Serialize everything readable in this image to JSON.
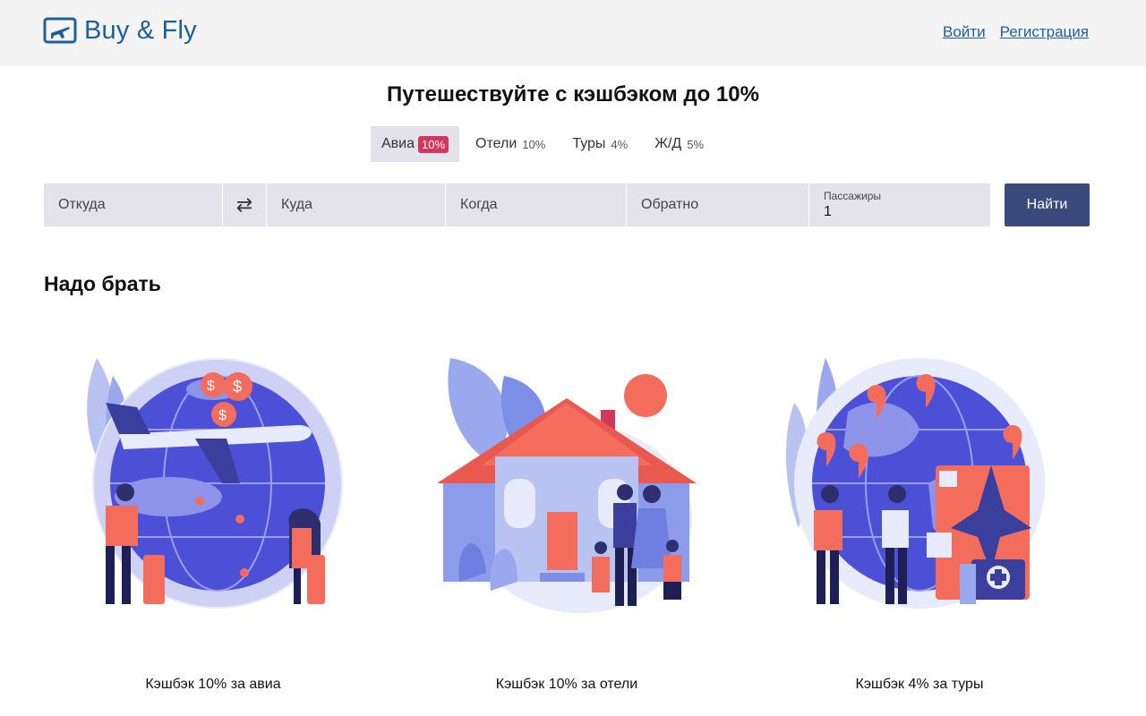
{
  "header": {
    "logo_text": "Buy & Fly",
    "login_label": "Войти",
    "register_label": "Регистрация"
  },
  "hero": {
    "title": "Путешествуйте с кэшбэком до 10%"
  },
  "tabs": [
    {
      "label": "Авиа",
      "pct": "10%",
      "active": true
    },
    {
      "label": "Отели",
      "pct": "10%",
      "active": false
    },
    {
      "label": "Туры",
      "pct": "4%",
      "active": false
    },
    {
      "label": "Ж/Д",
      "pct": "5%",
      "active": false
    }
  ],
  "search": {
    "from_placeholder": "Откуда",
    "to_placeholder": "Куда",
    "when_placeholder": "Когда",
    "return_placeholder": "Обратно",
    "passengers_label": "Пассажиры",
    "passengers_value": "1",
    "find_label": "Найти",
    "swap_icon": "swap-arrows-icon"
  },
  "section": {
    "title": "Надо брать"
  },
  "cards": [
    {
      "caption": "Кэшбэк 10% за авиа",
      "illustration": "airplane-globe-illustration"
    },
    {
      "caption": "Кэшбэк 10% за отели",
      "illustration": "house-family-illustration"
    },
    {
      "caption": "Кэшбэк 4% за туры",
      "illustration": "globe-map-pins-illustration"
    }
  ],
  "colors": {
    "brand_blue": "#1d5f9a",
    "button_navy": "#3b4a7c",
    "badge_red": "#d5375a",
    "field_bg": "#e4e3ec",
    "header_bg": "#f4f4f5"
  }
}
